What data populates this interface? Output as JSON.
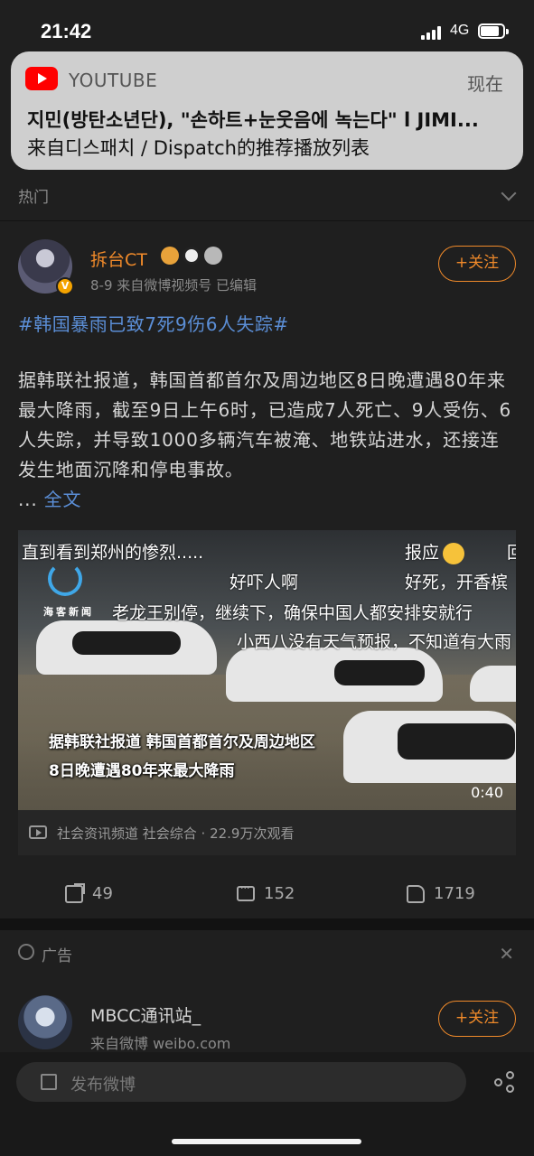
{
  "status": {
    "time": "21:42",
    "network": "4G"
  },
  "notification": {
    "app": "YOUTUBE",
    "time": "现在",
    "title": "지민(방탄소년단), \"손하트+눈웃음에 녹는다\" l JIMI...",
    "body": "来自디스패치 / Dispatch的推荐播放列表"
  },
  "section": {
    "label": "热门"
  },
  "post": {
    "username": "拆台CT",
    "meta": "8-9  来自微博视频号  已编辑",
    "follow_label": "+关注",
    "hashtag": "#韩国暴雨已致7死9伤6人失踪#",
    "content": "据韩联社报道，韩国首都首尔及周边地区8日晚遭遇80年来最大降雨，截至9日上午6时，已造成7人死亡、9人受伤、6人失踪，并导致1000多辆汽车被淹、地铁站进水，还接连发生地面沉降和停电事故。",
    "more_prefix": "... ",
    "more_label": "全文",
    "video": {
      "danmaku": [
        "直到看到郑州的惨烈.....",
        "报应",
        "回",
        "好吓人啊",
        "好死，开香槟",
        "老龙王别停，继续下，确保中国人都安排安就行",
        "小西八没有天气预报，不知道有大雨"
      ],
      "logo_text": "海客新闻",
      "caption_line1": "据韩联社报道 韩国首都首尔及周边地区",
      "caption_line2": "8日晚遭遇80年来最大降雨",
      "duration": "0:40",
      "source": "社会资讯频道 社会综合 · 22.9万次观看"
    },
    "actions": {
      "reposts": "49",
      "comments": "152",
      "likes": "1719"
    }
  },
  "ad": {
    "label": "广告",
    "close": "✕",
    "name": "MBCC通讯站_",
    "meta": "来自微博 weibo.com",
    "follow_label": "+关注"
  },
  "compose": {
    "placeholder": "发布微博"
  }
}
